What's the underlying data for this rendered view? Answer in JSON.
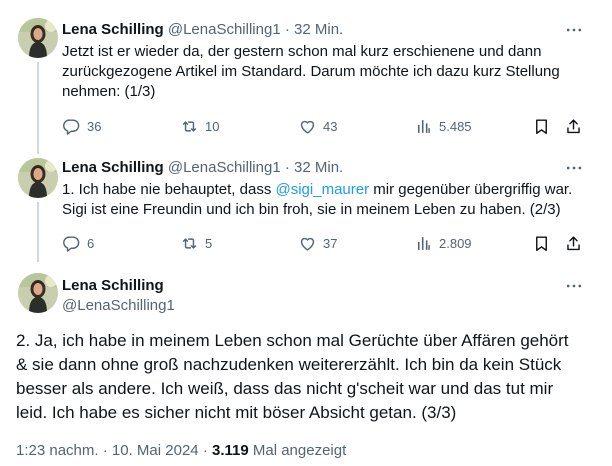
{
  "tweets": [
    {
      "name": "Lena Schilling",
      "handle": "@LenaSchilling1",
      "sep": "·",
      "time": "32 Min.",
      "lines": [
        "Jetzt ist er wieder da, der gestern schon mal kurz erschienene und dann",
        "zurückgezogene Artikel im Standard. Darum möchte ich dazu kurz Stellung",
        "nehmen: (1/3)"
      ],
      "replies": "36",
      "retweets": "10",
      "likes": "43",
      "views": "5.485"
    },
    {
      "name": "Lena Schilling",
      "handle": "@LenaSchilling1",
      "sep": "·",
      "time": "32 Min.",
      "line1_pre": "1. Ich habe nie behauptet, dass ",
      "mention": "@sigi_maurer",
      "line1_post": " mir gegenüber übergriffig war.",
      "line2": "Sigi ist eine Freundin und ich bin froh, sie in meinem Leben zu haben. (2/3)",
      "replies": "6",
      "retweets": "5",
      "likes": "37",
      "views": "2.809"
    }
  ],
  "main_tweet": {
    "name": "Lena Schilling",
    "handle": "@LenaSchilling1",
    "lines": [
      "2. Ja, ich habe in meinem Leben schon mal Gerüchte über Affären gehört",
      "& sie dann ohne groß nachzudenken weitererzählt. Ich bin da kein Stück",
      "besser als andere. Ich weiß, dass das nicht g'scheit war und das tut mir",
      "leid. Ich habe es sicher nicht mit böser Absicht getan. (3/3)"
    ],
    "time": "1:23 nachm.",
    "date": "10. Mai 2024",
    "sep": "·",
    "views_count": "3.119",
    "views_label": "Mal angezeigt"
  },
  "colors": {
    "text": "#0f1419",
    "secondary": "#536471",
    "link": "#1d9bf0",
    "thread_line": "#cfd9de"
  },
  "icons": [
    "more-icon",
    "reply-icon",
    "retweet-icon",
    "like-icon",
    "views-icon",
    "bookmark-icon",
    "share-icon"
  ]
}
